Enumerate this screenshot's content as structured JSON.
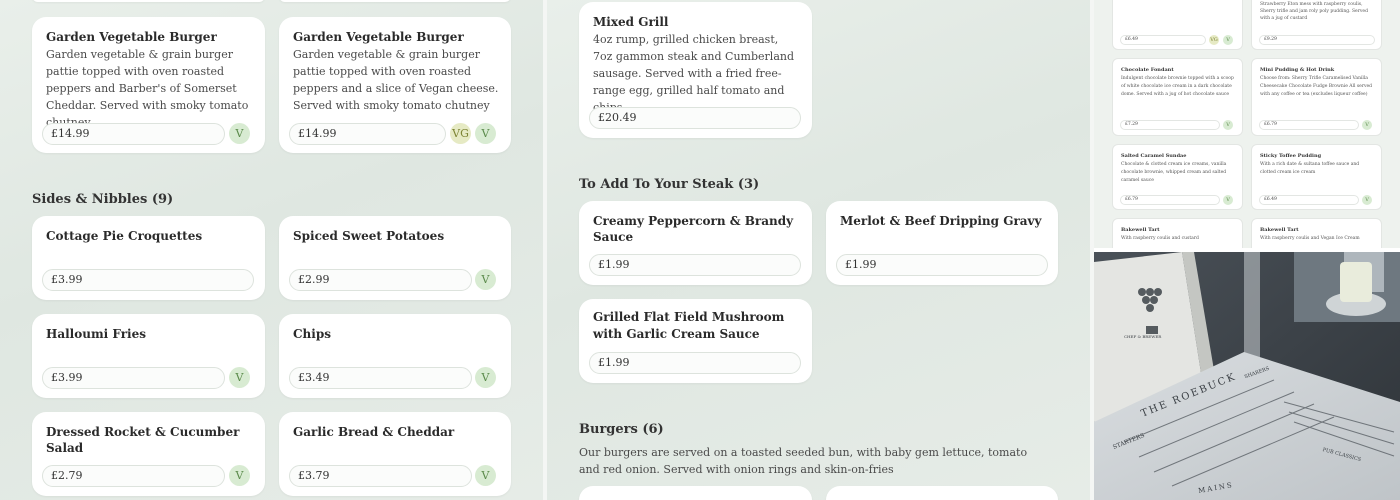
{
  "left_panel": {
    "top_cards": [
      {
        "title": "Garden Vegetable Burger",
        "desc": "Garden vegetable & grain burger pattie topped with oven roasted peppers and Barber's of Somerset Cheddar. Served with smoky tomato chutney",
        "price": "£14.99",
        "badges": [
          "V"
        ]
      },
      {
        "title": "Garden Vegetable Burger",
        "desc": "Garden vegetable & grain burger pattie topped with oven roasted peppers and a slice of Vegan cheese. Served with smoky tomato chutney",
        "price": "£14.99",
        "badges": [
          "VG",
          "V"
        ]
      }
    ],
    "section_title": "Sides & Nibbles (9)",
    "sides": [
      {
        "title": "Cottage Pie Croquettes",
        "price": "£3.99",
        "badges": []
      },
      {
        "title": "Spiced Sweet Potatoes",
        "price": "£2.99",
        "badges": [
          "V"
        ]
      },
      {
        "title": "Halloumi Fries",
        "price": "£3.99",
        "badges": [
          "V"
        ]
      },
      {
        "title": "Chips",
        "price": "£3.49",
        "badges": [
          "V"
        ]
      },
      {
        "title": "Dressed Rocket & Cucumber Salad",
        "price": "£2.79",
        "badges": [
          "V"
        ]
      },
      {
        "title": "Garlic Bread & Cheddar",
        "price": "£3.79",
        "badges": [
          "V"
        ]
      }
    ]
  },
  "mid_panel": {
    "mixed_grill": {
      "title": "Mixed Grill",
      "desc": "4oz rump, grilled chicken breast, 7oz gammon steak and Cumberland sausage. Served with a fried free-range egg, grilled half tomato and chips",
      "price": "£20.49"
    },
    "steak_section_title": "To Add To Your Steak (3)",
    "steak_addons": [
      {
        "title": "Creamy Peppercorn & Brandy Sauce",
        "price": "£1.99"
      },
      {
        "title": "Merlot & Beef Dripping Gravy",
        "price": "£1.99"
      },
      {
        "title": "Grilled Flat Field Mushroom with Garlic Cream Sauce",
        "price": "£1.99"
      }
    ],
    "burgers_section_title": "Burgers (6)",
    "burgers_note": "Our burgers are served on a toasted seeded bun, with baby gem lettuce, tomato and red onion. Served with onion rings and skin-on-fries"
  },
  "right_panel": {
    "top_left": {
      "price": "£6.49",
      "badges": [
        "VG",
        "V"
      ]
    },
    "top_right": {
      "desc": "Strawberry Eton mess with raspberry coulis, Sherry trifle and jam roly poly pudding. Served with a jug of custard",
      "price": "£9.29"
    },
    "cards": [
      {
        "title": "Chocolate Fondant",
        "desc": "Indulgent chocolate brownie topped with a scoop of white chocolate ice cream in a dark chocolate dome. Served with a jug of hot chocolate sauce",
        "price": "£7.29",
        "badges": [
          "V"
        ]
      },
      {
        "title": "Mini Pudding & Hot Drink",
        "desc": "Choose from: Sherry Trifle Caramelised Vanilla Cheesecake Chocolate Fudge Brownie All served with any coffee or tea (excludes liqueur coffee)",
        "price": "£6.79",
        "badges": [
          "V"
        ]
      },
      {
        "title": "Salted Caramel Sundae",
        "desc": "Chocolate & clotted cream ice creams, vanilla chocolate brownie, whipped cream and salted caramel sauce",
        "price": "£6.79",
        "badges": [
          "V"
        ]
      },
      {
        "title": "Sticky Toffee Pudding",
        "desc": "With a rich date & sultana toffee sauce and clotted cream ice cream",
        "price": "£6.49",
        "badges": [
          "V"
        ]
      },
      {
        "title": "Bakewell Tart",
        "desc": "With raspberry coulis and custard",
        "price": "",
        "badges": []
      },
      {
        "title": "Bakewell Tart",
        "desc": "With raspberry coulis and Vegan Ice Cream",
        "price": "",
        "badges": []
      }
    ],
    "photo": {
      "menu_heading": "THE ROEBUCK",
      "brand": "CHEF & BREWER",
      "sections": [
        "STARTERS",
        "SHARERS",
        "PUB CLASSICS",
        "MAINS"
      ]
    }
  },
  "colors": {
    "background": "#e3eae4",
    "card": "#ffffff",
    "badge_v": "#d8ebd2",
    "badge_vg": "#e6eac4"
  }
}
